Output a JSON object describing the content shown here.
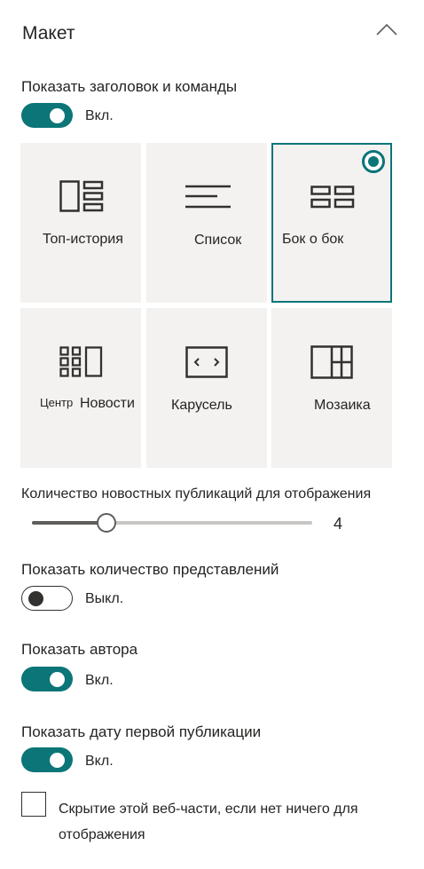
{
  "section": {
    "title": "Макет",
    "collapse_icon": "chevron-up-icon"
  },
  "show_header": {
    "label": "Показать заголовок и команды",
    "state": "Вкл.",
    "on": true
  },
  "layouts": [
    {
      "label": "Топ-история",
      "icon": "top-story-icon",
      "selected": false
    },
    {
      "label": "Список",
      "icon": "list-icon",
      "selected": false
    },
    {
      "label": "Бок о бок",
      "icon": "side-by-side-icon",
      "selected": true
    },
    {
      "label_a": "Центр",
      "label_b": "Новости",
      "icon": "hub-news-icon",
      "selected": false
    },
    {
      "label": "Карусель",
      "icon": "carousel-icon",
      "selected": false
    },
    {
      "label": "Мозаика",
      "icon": "tiles-icon",
      "selected": false
    }
  ],
  "news_count": {
    "label": "Количество новостных публикаций для отображения",
    "value": "4",
    "min": 1,
    "max": 36,
    "current": 4
  },
  "show_views": {
    "label": "Показать количество представлений",
    "state": "Выкл.",
    "on": false
  },
  "show_author": {
    "label": "Показать автора",
    "state": "Вкл.",
    "on": true
  },
  "show_date": {
    "label": "Показать дату первой публикации",
    "state": "Вкл.",
    "on": true
  },
  "hide_empty": {
    "label": "Скрытие этой веб-части, если нет ничего для отображения",
    "checked": false
  },
  "colors": {
    "accent": "#0b7578",
    "tile_bg": "#f3f2f1",
    "text": "#252423"
  }
}
